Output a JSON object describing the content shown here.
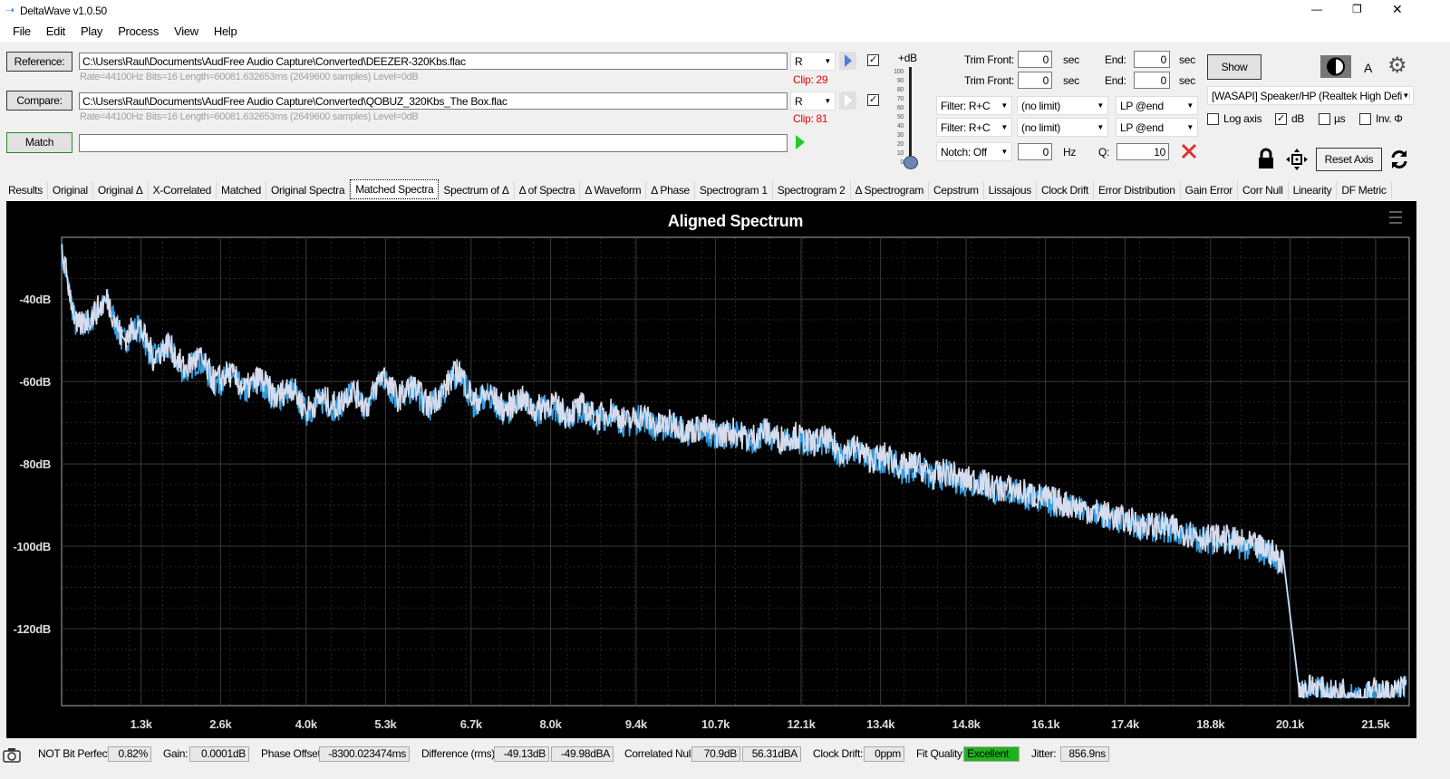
{
  "window": {
    "title": "DeltaWave v1.0.50",
    "minimize": "—",
    "restore": "❐",
    "close": "✕"
  },
  "menu": [
    "File",
    "Edit",
    "Play",
    "Process",
    "View",
    "Help"
  ],
  "reference": {
    "label": "Reference:",
    "path": "C:\\Users\\Raul\\Documents\\AudFree Audio Capture\\Converted\\DEEZER-320Kbs.flac",
    "info": "Rate=44100Hz Bits=16 Length=60081.632653ms (2649600 samples) Level=0dB",
    "channel": "R",
    "clip": "Clip: 29",
    "checked": true
  },
  "compare": {
    "label": "Compare:",
    "path": "C:\\Users\\Raul\\Documents\\AudFree Audio Capture\\Converted\\QOBUZ_320Kbs_The Box.flac",
    "info": "Rate=44100Hz Bits=16 Length=60081.632653ms (2649600 samples) Level=0dB",
    "channel": "R",
    "clip": "Clip: 81",
    "checked": true
  },
  "match": {
    "label": "Match",
    "value": ""
  },
  "level_slider": {
    "label": "+dB",
    "ticks": [
      "100",
      "90",
      "80",
      "70",
      "60",
      "50",
      "40",
      "30",
      "20",
      "10",
      "0"
    ],
    "value": 0
  },
  "trim": [
    {
      "label": "Trim Front:",
      "front": "0",
      "unit": "sec",
      "end_label": "End:",
      "end": "0",
      "end_unit": "sec"
    },
    {
      "label": "Trim Front:",
      "front": "0",
      "unit": "sec",
      "end_label": "End:",
      "end": "0",
      "end_unit": "sec"
    }
  ],
  "filters": [
    {
      "filter": "Filter: R+C",
      "limit": "(no limit)",
      "lp": "LP @end"
    },
    {
      "filter": "Filter: R+C",
      "limit": "(no limit)",
      "lp": "LP @end"
    }
  ],
  "notch": {
    "label": "Notch: Off",
    "hz": "0",
    "hz_unit": "Hz",
    "q_label": "Q:",
    "q": "10"
  },
  "right": {
    "show": "Show",
    "a_label": "A",
    "device": "[WASAPI] Speaker/HP (Realtek High Defini",
    "log_axis": "Log axis",
    "log_checked": false,
    "db": "dB",
    "db_checked": true,
    "us": "µs",
    "us_checked": false,
    "inv": "Inv. Φ",
    "inv_checked": false,
    "reset_axis": "Reset Axis"
  },
  "tabs": [
    "Results",
    "Original",
    "Original Δ",
    "X-Correlated",
    "Matched",
    "Original Spectra",
    "Matched Spectra",
    "Spectrum of Δ",
    "Δ of Spectra",
    "Δ Waveform",
    "Δ Phase",
    "Spectrogram 1",
    "Spectrogram 2",
    "Δ Spectrogram",
    "Cepstrum",
    "Lissajous",
    "Clock Drift",
    "Error Distribution",
    "Gain Error",
    "Corr Null",
    "Linearity",
    "DF Metric"
  ],
  "active_tab": "Matched Spectra",
  "chart_data": {
    "type": "line",
    "title": "Aligned Spectrum",
    "xlabel": "",
    "ylabel": "",
    "xlim": [
      0,
      22050
    ],
    "ylim": [
      -138.7,
      -25
    ],
    "x_ticks": [
      "1.3k",
      "2.6k",
      "4.0k",
      "5.3k",
      "6.7k",
      "8.0k",
      "9.4k",
      "10.7k",
      "12.1k",
      "13.4k",
      "14.8k",
      "16.1k",
      "17.4k",
      "18.8k",
      "20.1k",
      "21.5k"
    ],
    "x_tick_values": [
      1300,
      2600,
      4000,
      5300,
      6700,
      8000,
      9400,
      10700,
      12100,
      13400,
      14800,
      16100,
      17400,
      18800,
      20100,
      21500
    ],
    "y_ticks": [
      "-40dB",
      "-60dB",
      "-80dB",
      "-100dB",
      "-120dB"
    ],
    "y_tick_values": [
      -40,
      -60,
      -80,
      -100,
      -120
    ],
    "grid": true,
    "colors": {
      "reference": "#d8dcec",
      "compare": "#3aa0e0",
      "background": "#000000",
      "grid": "#3a3a3a"
    },
    "x_step_hz": 250,
    "values": [
      -28,
      -47,
      -44,
      -40,
      -50,
      -46,
      -54,
      -51,
      -57,
      -54,
      -60,
      -58,
      -62,
      -59,
      -64,
      -61,
      -67,
      -64,
      -66,
      -62,
      -66,
      -58,
      -64,
      -61,
      -66,
      -62,
      -57,
      -65,
      -63,
      -67,
      -64,
      -67,
      -65,
      -68,
      -66,
      -69,
      -67,
      -70,
      -68,
      -71,
      -70,
      -72,
      -71,
      -73,
      -72,
      -74,
      -72,
      -74,
      -73,
      -75,
      -74,
      -77,
      -76,
      -79,
      -78,
      -81,
      -80,
      -83,
      -82,
      -84,
      -84,
      -86,
      -86,
      -87,
      -88,
      -89,
      -90,
      -91,
      -92,
      -93,
      -94,
      -95,
      -95,
      -96,
      -97,
      -98,
      -98,
      -99,
      -100,
      -101,
      -104,
      -135,
      -134,
      -136,
      -135,
      -137,
      -135,
      -136,
      -134
    ]
  },
  "status": {
    "bit_perfect": "NOT Bit Perfect",
    "bit_perfect_val": "0.82%",
    "gain_label": "Gain:",
    "gain": "0.0001dB",
    "phase_label": "Phase Offset:",
    "phase": "-8300.023474ms",
    "diff_label": "Difference (rms):",
    "diff_db": "-49.13dB",
    "diff_dba": "-49.98dBA",
    "corr_label": "Correlated Null:",
    "corr_db": "70.9dB",
    "corr_dba": "56.31dBA",
    "drift_label": "Clock Drift:",
    "drift": "0ppm",
    "fit_label": "Fit Quality:",
    "fit": "Excellent",
    "jitter_label": "Jitter:",
    "jitter": "856.9ns"
  }
}
